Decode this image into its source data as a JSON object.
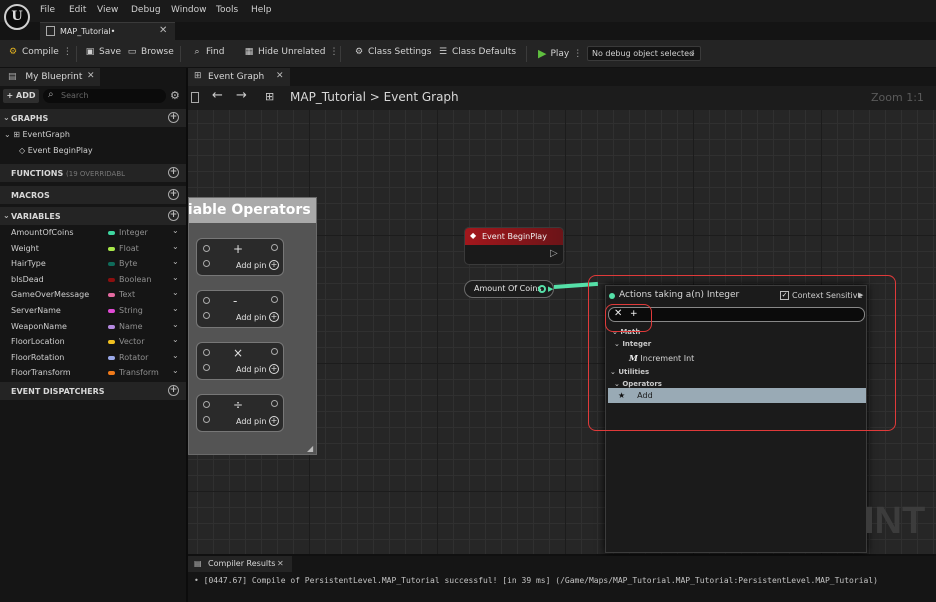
{
  "menubar": {
    "items": [
      "File",
      "Edit",
      "View",
      "Debug",
      "Window",
      "Tools",
      "Help"
    ]
  },
  "document_tab": {
    "label": "MAP_Tutorial•"
  },
  "toolbar": {
    "compile": "Compile",
    "save": "Save",
    "browse": "Browse",
    "find": "Find",
    "hide_unrelated": "Hide Unrelated",
    "class_settings": "Class Settings",
    "class_defaults": "Class Defaults",
    "play": "Play",
    "debug_object": "No debug object selected",
    "play_color": "#5fbf3f"
  },
  "my_blueprint": {
    "tab_label": "My Blueprint",
    "add_label": "ADD",
    "search_placeholder": "Search",
    "graphs_header": "GRAPHS",
    "event_graph": "EventGraph",
    "event_beginplay": "Event BeginPlay",
    "functions_header": "FUNCTIONS",
    "functions_note": "(19 OVERRIDABL",
    "macros_header": "MACROS",
    "variables_header": "VARIABLES",
    "dispatchers_header": "EVENT DISPATCHERS",
    "variables": [
      {
        "name": "AmountOfCoins",
        "type": "Integer",
        "color": "#3ed6a0"
      },
      {
        "name": "Weight",
        "type": "Float",
        "color": "#a8e84a"
      },
      {
        "name": "HairType",
        "type": "Byte",
        "color": "#0f6b5a"
      },
      {
        "name": "bIsDead",
        "type": "Boolean",
        "color": "#8c0f0f"
      },
      {
        "name": "GameOverMessage",
        "type": "Text",
        "color": "#e46aa0"
      },
      {
        "name": "ServerName",
        "type": "String",
        "color": "#e04ad4"
      },
      {
        "name": "WeaponName",
        "type": "Name",
        "color": "#b58ae0"
      },
      {
        "name": "FloorLocation",
        "type": "Vector",
        "color": "#f0c020"
      },
      {
        "name": "FloorRotation",
        "type": "Rotator",
        "color": "#9aa8e8"
      },
      {
        "name": "FloorTransform",
        "type": "Transform",
        "color": "#f07a1a"
      }
    ]
  },
  "graph_tab": {
    "label": "Event Graph"
  },
  "breadcrumb": {
    "root": "MAP_Tutorial",
    "separator": ">",
    "current": "Event Graph",
    "zoom": "Zoom 1:1"
  },
  "comment_box": {
    "title": "riable Operators",
    "nodes": [
      {
        "symbol": "+",
        "add_pin": "Add pin"
      },
      {
        "symbol": "-",
        "add_pin": "Add pin"
      },
      {
        "symbol": "×",
        "add_pin": "Add pin"
      },
      {
        "symbol": "÷",
        "add_pin": "Add pin"
      }
    ]
  },
  "event_node": {
    "title": "Event BeginPlay"
  },
  "getter_node": {
    "label": "Amount Of Coins"
  },
  "action_menu": {
    "title": "Actions taking a(n) Integer",
    "context_label": "Context Sensitive",
    "search_value": "+",
    "items": [
      {
        "label": "Math",
        "kind": "category"
      },
      {
        "label": "Integer",
        "kind": "category"
      },
      {
        "label": "Increment Int",
        "kind": "action"
      },
      {
        "label": "Utilities",
        "kind": "category"
      },
      {
        "label": "Operators",
        "kind": "category"
      },
      {
        "label": "Add",
        "kind": "action"
      }
    ]
  },
  "watermark": "INT",
  "compiler": {
    "tab_label": "Compiler Results",
    "log": "[0447.67] Compile of PersistentLevel.MAP_Tutorial successful! [in 39 ms] (/Game/Maps/MAP_Tutorial.MAP_Tutorial:PersistentLevel.MAP_Tutorial)"
  }
}
